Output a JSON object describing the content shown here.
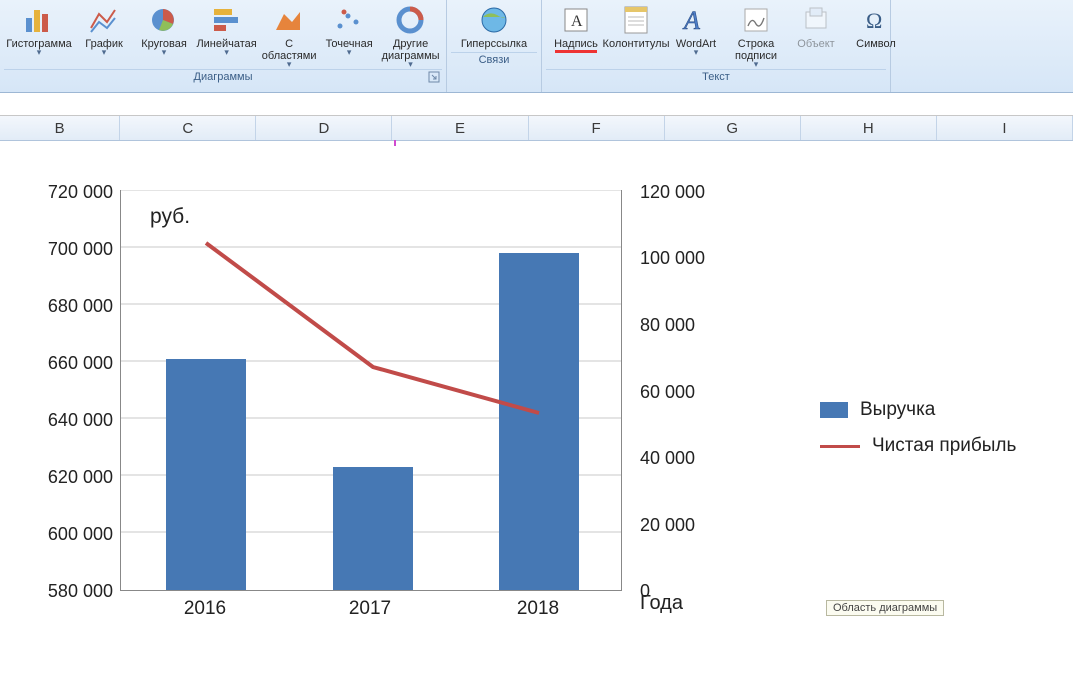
{
  "ribbon": {
    "groups": {
      "charts": {
        "title": "Диаграммы",
        "buttons": {
          "column": "Гистограмма",
          "line": "График",
          "pie": "Круговая",
          "bar": "Линейчатая",
          "area": "С\nобластями",
          "scatter": "Точечная",
          "other": "Другие\nдиаграммы"
        }
      },
      "links": {
        "title": "Связи",
        "buttons": {
          "hyperlink": "Гиперссылка"
        }
      },
      "text": {
        "title": "Текст",
        "buttons": {
          "textbox": "Надпись",
          "headerfooter": "Колонтитулы",
          "wordart": "WordArt",
          "sigline": "Строка\nподписи",
          "object": "Объект",
          "symbol": "Символ"
        }
      }
    }
  },
  "columns": [
    "B",
    "C",
    "D",
    "E",
    "F",
    "G",
    "H",
    "I"
  ],
  "chart_text": {
    "unit_box": "руб.",
    "xaxis_title": "Года",
    "tooltip": "Область диаграммы"
  },
  "legend": {
    "bar": "Выручка",
    "line": "Чистая прибыль"
  },
  "chart_data": {
    "type": "combo",
    "categories": [
      "2016",
      "2017",
      "2018"
    ],
    "series": [
      {
        "name": "Выручка",
        "type": "bar",
        "axis": "left",
        "values": [
          661000,
          623000,
          698000
        ]
      },
      {
        "name": "Чистая прибыль",
        "type": "line",
        "axis": "right",
        "values": [
          104000,
          67000,
          53000
        ]
      }
    ],
    "axes": {
      "left": {
        "min": 580000,
        "max": 720000,
        "step": 20000,
        "ticks": [
          "580 000",
          "600 000",
          "620 000",
          "640 000",
          "660 000",
          "680 000",
          "700 000",
          "720 000"
        ]
      },
      "right": {
        "min": 0,
        "max": 120000,
        "step": 20000,
        "ticks": [
          "0",
          "20 000",
          "40 000",
          "60 000",
          "80 000",
          "100 000",
          "120 000"
        ]
      }
    },
    "xlabel": "Года",
    "ylabel_left": "",
    "ylabel_right": "",
    "annotations": [
      "руб."
    ]
  }
}
